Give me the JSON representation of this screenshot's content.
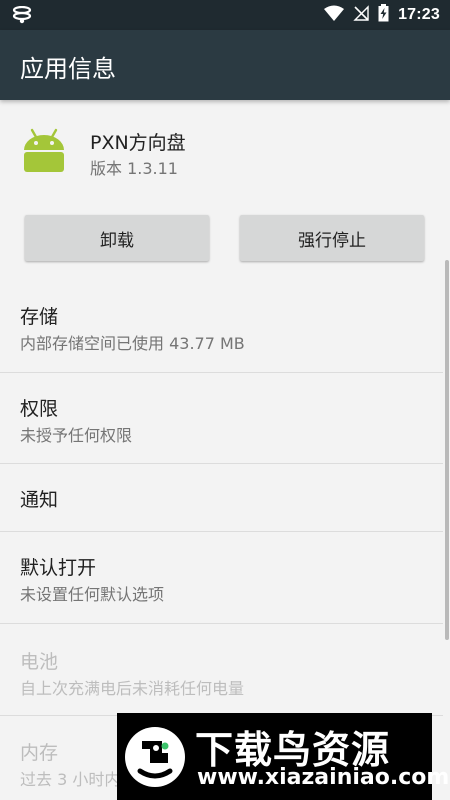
{
  "status_bar": {
    "time": "17:23",
    "icons": [
      "hotspot-icon",
      "wifi-icon",
      "no-signal-icon",
      "battery-charging-icon"
    ]
  },
  "app_bar": {
    "title": "应用信息"
  },
  "app": {
    "name": "PXN方向盘",
    "version": "版本 1.3.11",
    "icon": "android-robot-icon"
  },
  "buttons": {
    "uninstall": "卸载",
    "force_stop": "强行停止"
  },
  "settings": {
    "storage": {
      "title": "存储",
      "subtitle": "内部存储空间已使用 43.77 MB"
    },
    "permissions": {
      "title": "权限",
      "subtitle": "未授予任何权限"
    },
    "notifications": {
      "title": "通知"
    },
    "open_by_default": {
      "title": "默认打开",
      "subtitle": "未设置任何默认选项"
    },
    "battery": {
      "title": "电池",
      "subtitle": "自上次充满电后未消耗任何电量"
    },
    "memory": {
      "title": "内存",
      "subtitle": "过去 3 小时内"
    }
  },
  "watermark": {
    "title": "下载鸟资源",
    "url": "www.xiazainiao.com"
  },
  "colors": {
    "status_bar": "#1f2a30",
    "app_bar": "#2b3a42",
    "android_green": "#a4c639",
    "button": "#d6d7d7"
  }
}
